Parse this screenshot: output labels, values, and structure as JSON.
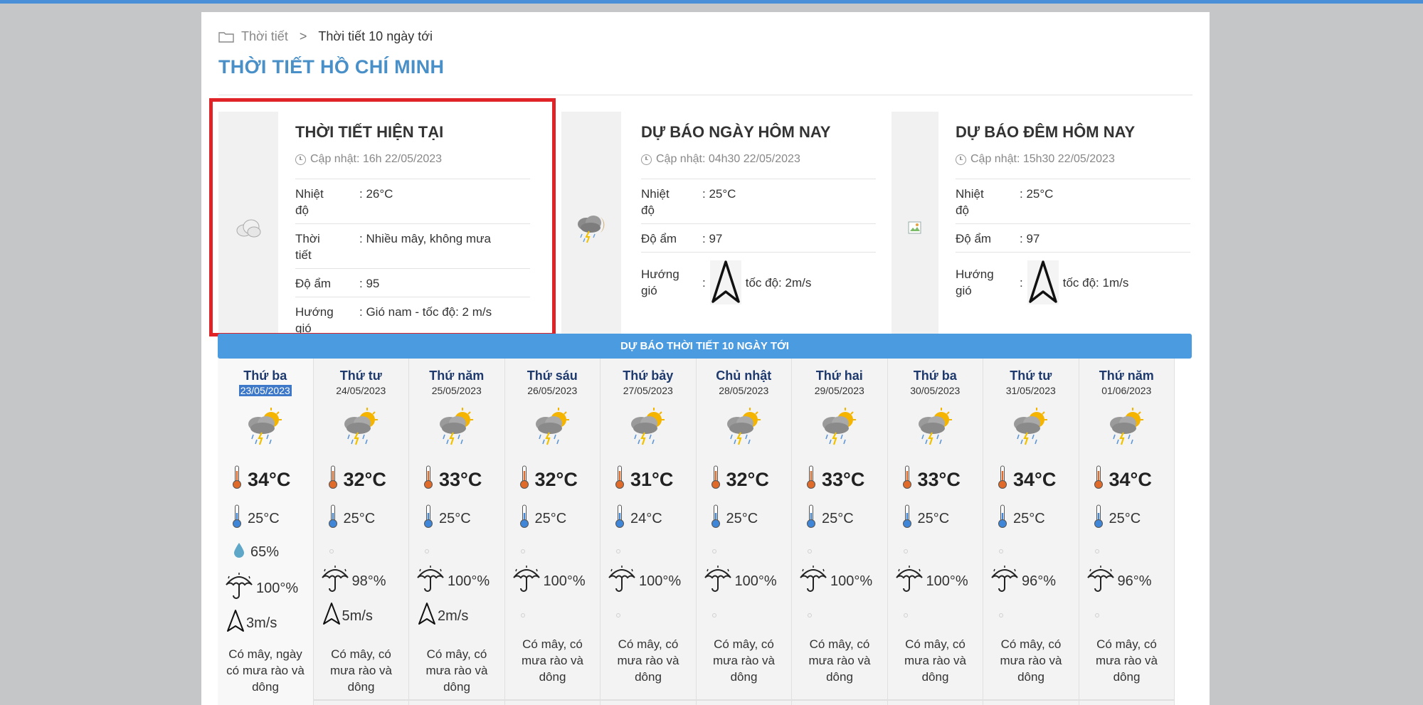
{
  "breadcrumb": {
    "items": [
      "Thời tiết",
      "Thời tiết 10 ngày tới"
    ],
    "separator": ">"
  },
  "page_title": "THỜI TIẾT HỒ CHÍ MINH",
  "cards": [
    {
      "title": "THỜI TIẾT HIỆN TẠI",
      "updated": "Cập nhật: 16h 22/05/2023",
      "icon": "cloudy-icon",
      "rows": [
        {
          "label": "Nhiệt độ",
          "value": ": 26°C"
        },
        {
          "label": "Thời tiết",
          "value": ": Nhiều mây, không mưa"
        },
        {
          "label": "Độ ẩm",
          "value": ": 95"
        },
        {
          "label": "Hướng gió",
          "value": ": Gió nam - tốc độ: 2 m/s"
        }
      ]
    },
    {
      "title": "DỰ BÁO NGÀY HÔM NAY",
      "updated": "Cập nhật: 04h30 22/05/2023",
      "icon": "thunderstorm-icon",
      "rows": [
        {
          "label": "Nhiệt độ",
          "value": ": 25°C"
        },
        {
          "label": "Độ ẩm",
          "value": ": 97"
        },
        {
          "label": "Hướng gió",
          "colon": ":",
          "value": "tốc độ: 2m/s"
        }
      ]
    },
    {
      "title": "DỰ BÁO ĐÊM HÔM NAY",
      "updated": "Cập nhật: 15h30 22/05/2023",
      "icon": "broken-image-icon",
      "rows": [
        {
          "label": "Nhiệt độ",
          "value": ": 25°C"
        },
        {
          "label": "Độ ẩm",
          "value": ": 97"
        },
        {
          "label": "Hướng gió",
          "colon": ":",
          "value": "tốc độ: 1m/s"
        }
      ]
    }
  ],
  "ten_day": {
    "header": "DỰ BÁO THỜI TIẾT 10 NGÀY TỚI",
    "days": [
      {
        "name": "Thứ ba",
        "date": "23/05/2023",
        "hi": "34°C",
        "lo": "25°C",
        "humidity": "65%",
        "rain": "100°%",
        "wind": "3m/s",
        "desc": "Có mây, ngày có mưa rào và dông"
      },
      {
        "name": "Thứ tư",
        "date": "24/05/2023",
        "hi": "32°C",
        "lo": "25°C",
        "rain": "98°%",
        "wind": "5m/s",
        "desc": "Có mây, có mưa rào và dông"
      },
      {
        "name": "Thứ năm",
        "date": "25/05/2023",
        "hi": "33°C",
        "lo": "25°C",
        "rain": "100°%",
        "wind": "2m/s",
        "desc": "Có mây, có mưa rào và dông"
      },
      {
        "name": "Thứ sáu",
        "date": "26/05/2023",
        "hi": "32°C",
        "lo": "25°C",
        "rain": "100°%",
        "desc": "Có mây, có mưa rào và dông"
      },
      {
        "name": "Thứ bảy",
        "date": "27/05/2023",
        "hi": "31°C",
        "lo": "24°C",
        "rain": "100°%",
        "desc": "Có mây, có mưa rào và dông"
      },
      {
        "name": "Chủ nhật",
        "date": "28/05/2023",
        "hi": "32°C",
        "lo": "25°C",
        "rain": "100°%",
        "desc": "Có mây, có mưa rào và dông"
      },
      {
        "name": "Thứ hai",
        "date": "29/05/2023",
        "hi": "33°C",
        "lo": "25°C",
        "rain": "100°%",
        "desc": "Có mây, có mưa rào và dông"
      },
      {
        "name": "Thứ ba",
        "date": "30/05/2023",
        "hi": "33°C",
        "lo": "25°C",
        "rain": "100°%",
        "desc": "Có mây, có mưa rào và dông"
      },
      {
        "name": "Thứ tư",
        "date": "31/05/2023",
        "hi": "34°C",
        "lo": "25°C",
        "rain": "96°%",
        "desc": "Có mây, có mưa rào và dông"
      },
      {
        "name": "Thứ năm",
        "date": "01/06/2023",
        "hi": "34°C",
        "lo": "25°C",
        "rain": "96°%",
        "desc": "Có mây, có mưa rào và dông"
      }
    ]
  },
  "colors": {
    "accent": "#4a90c8",
    "header_bar": "#4a9be0",
    "highlight": "#e02327",
    "day_name": "#1e3a6e"
  }
}
